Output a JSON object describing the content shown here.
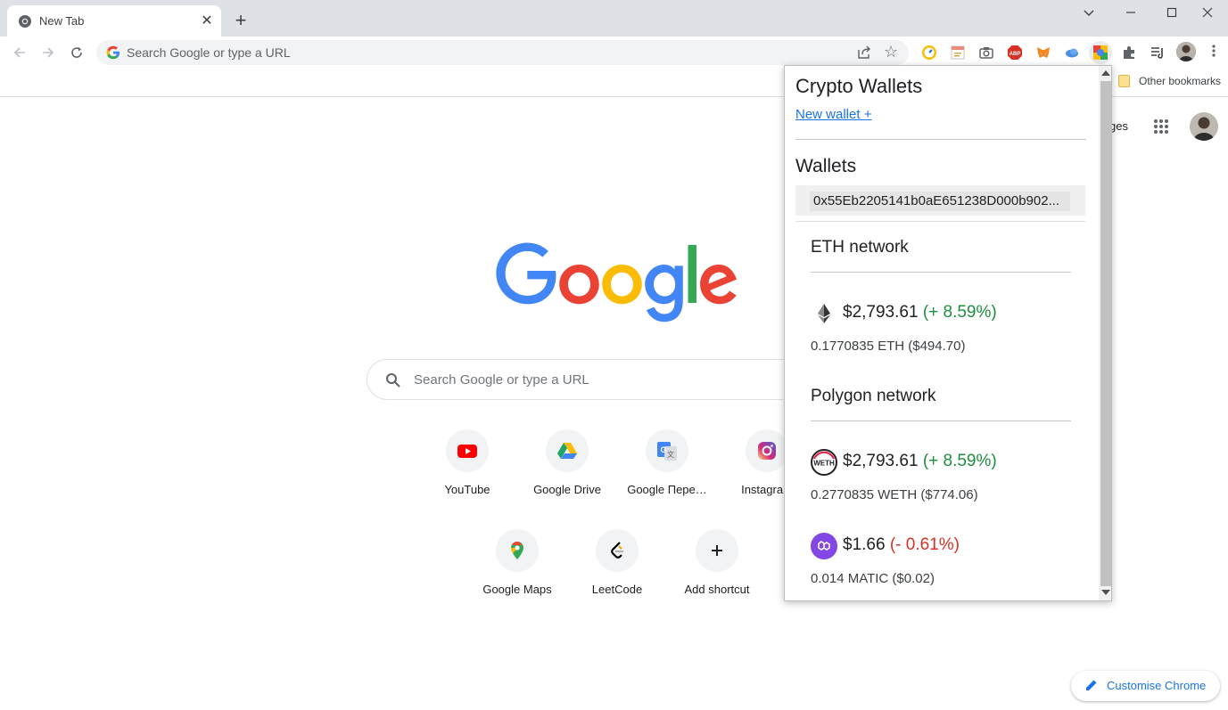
{
  "browser": {
    "tab": {
      "title": "New Tab",
      "close": "✕"
    },
    "new_tab": "+",
    "omnibox": {
      "placeholder": "Search Google or type a URL"
    },
    "bookmarks": {
      "other": "Other bookmarks"
    }
  },
  "ntp": {
    "images_link": "ges",
    "search_placeholder": "Search Google or type a URL",
    "shortcuts": [
      {
        "label": "YouTube"
      },
      {
        "label": "Google Drive"
      },
      {
        "label": "Google Пере…"
      },
      {
        "label": "Instagram"
      },
      {
        "label": "Google Maps"
      },
      {
        "label": "LeetCode"
      },
      {
        "label": "Add shortcut"
      }
    ],
    "customise": "Customise Chrome"
  },
  "popup": {
    "title": "Crypto Wallets",
    "new_wallet": "New wallet +",
    "wallets_heading": "Wallets",
    "wallet_address": "0x55Eb2205141b0aE651238D000b902...",
    "networks": [
      {
        "name": "ETH network",
        "assets": [
          {
            "price": "$2,793.61",
            "change": "(+ 8.59%)",
            "amount": "0.1770835 ETH ($494.70)"
          }
        ]
      },
      {
        "name": "Polygon network",
        "assets": [
          {
            "price": "$2,793.61",
            "change": "(+ 8.59%)",
            "amount": "0.2770835 WETH ($774.06)"
          },
          {
            "price": "$1.66",
            "change": "(- 0.61%)",
            "amount": "0.014 MATIC ($0.02)"
          }
        ]
      }
    ]
  },
  "colors": {
    "positive": "#1e8e3e",
    "negative": "#d93025",
    "link": "#1a73e8"
  }
}
